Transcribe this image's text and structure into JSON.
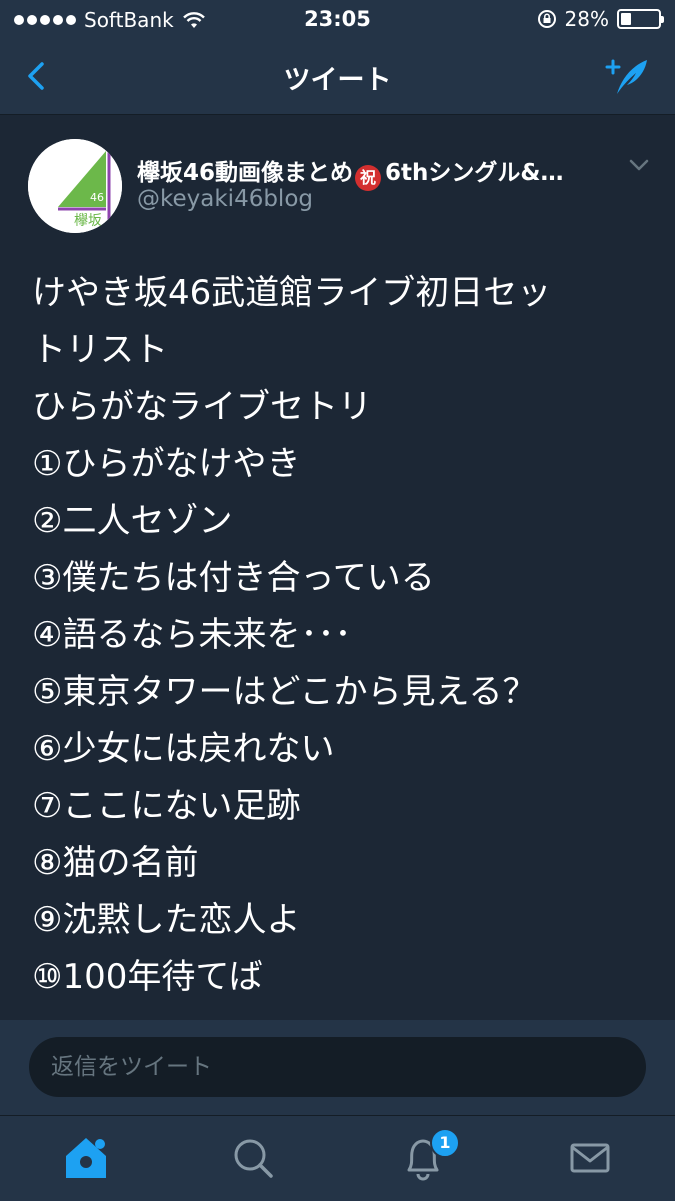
{
  "status_bar": {
    "carrier": "SoftBank",
    "time": "23:05",
    "battery_percent_text": "28%",
    "battery_level": 0.28,
    "icons": [
      "signal-dots-icon",
      "wifi-icon",
      "rotation-lock-icon",
      "battery-icon"
    ]
  },
  "nav": {
    "title": "ツイート",
    "back_icon": "chevron-left-icon",
    "compose_icon": "compose-tweet-icon"
  },
  "tweet": {
    "author_name_prefix": "欅坂46動画像まとめ",
    "celebrate_emoji": "祝",
    "author_name_suffix": "6thシングル&…",
    "author_handle": "@keyaki46blog",
    "avatar_text_top": "46",
    "avatar_text_bottom": "欅坂",
    "lines": [
      "けやき坂46武道館ライブ初日セッ",
      "トリスト",
      "ひらがなライブセトリ",
      "①ひらがなけやき",
      "②二人セゾン",
      "③僕たちは付き合っている",
      "④語るなら未来を･･･",
      "⑤東京タワーはどこから見える？",
      "⑥少女には戻れない",
      "⑦ここにない足跡",
      "⑧猫の名前",
      "⑨沈黙した恋人よ",
      "⑩100年待てば"
    ]
  },
  "reply": {
    "placeholder": "返信をツイート"
  },
  "tabs": {
    "items": [
      "home-icon",
      "search-icon",
      "notifications-icon",
      "messages-icon"
    ],
    "notification_badge": "1"
  },
  "colors": {
    "background": "#1c2735",
    "bars": "#243447",
    "accent": "#1da1f2",
    "muted": "#8899a6"
  }
}
